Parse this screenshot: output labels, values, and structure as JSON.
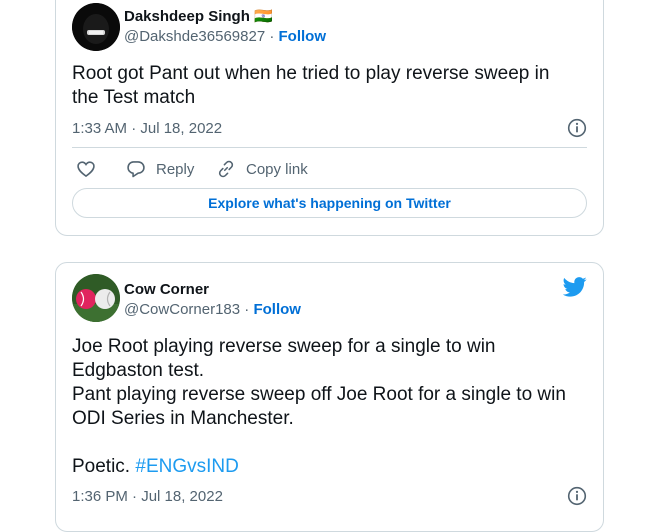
{
  "tweets": [
    {
      "user_name": "Dakshdeep Singh",
      "flag": "🇮🇳",
      "handle": "@Dakshde36569827",
      "separator": " · ",
      "follow_label": "Follow",
      "text": "Root got Pant out when he tried to play reverse sweep in\nthe Test match",
      "timestamp": "1:33 AM · Jul 18, 2022",
      "actions": {
        "reply_label": "Reply",
        "copy_link_label": "Copy link"
      },
      "explore_label": "Explore what's happening on Twitter"
    },
    {
      "user_name": "Cow Corner",
      "handle": "@CowCorner183",
      "separator": " · ",
      "follow_label": "Follow",
      "text": "Joe Root playing reverse sweep for a single to win\nEdgbaston test.\nPant playing reverse sweep off Joe Root for a single to win\nODI Series in Manchester.\n\nPoetic. ",
      "hashtag": "#ENGvsIND",
      "timestamp": "1:36 PM · Jul 18, 2022"
    }
  ],
  "colors": {
    "link_blue": "#006fd6",
    "hashtag_blue": "#1d9bf0",
    "twitter_bird": "#1d9bf0",
    "secondary_text": "#536471",
    "border": "#cfd9de",
    "like_pink": "#f91880"
  },
  "icons": [
    "info-icon",
    "heart-icon",
    "reply-icon",
    "link-icon",
    "twitter-bird-icon"
  ]
}
